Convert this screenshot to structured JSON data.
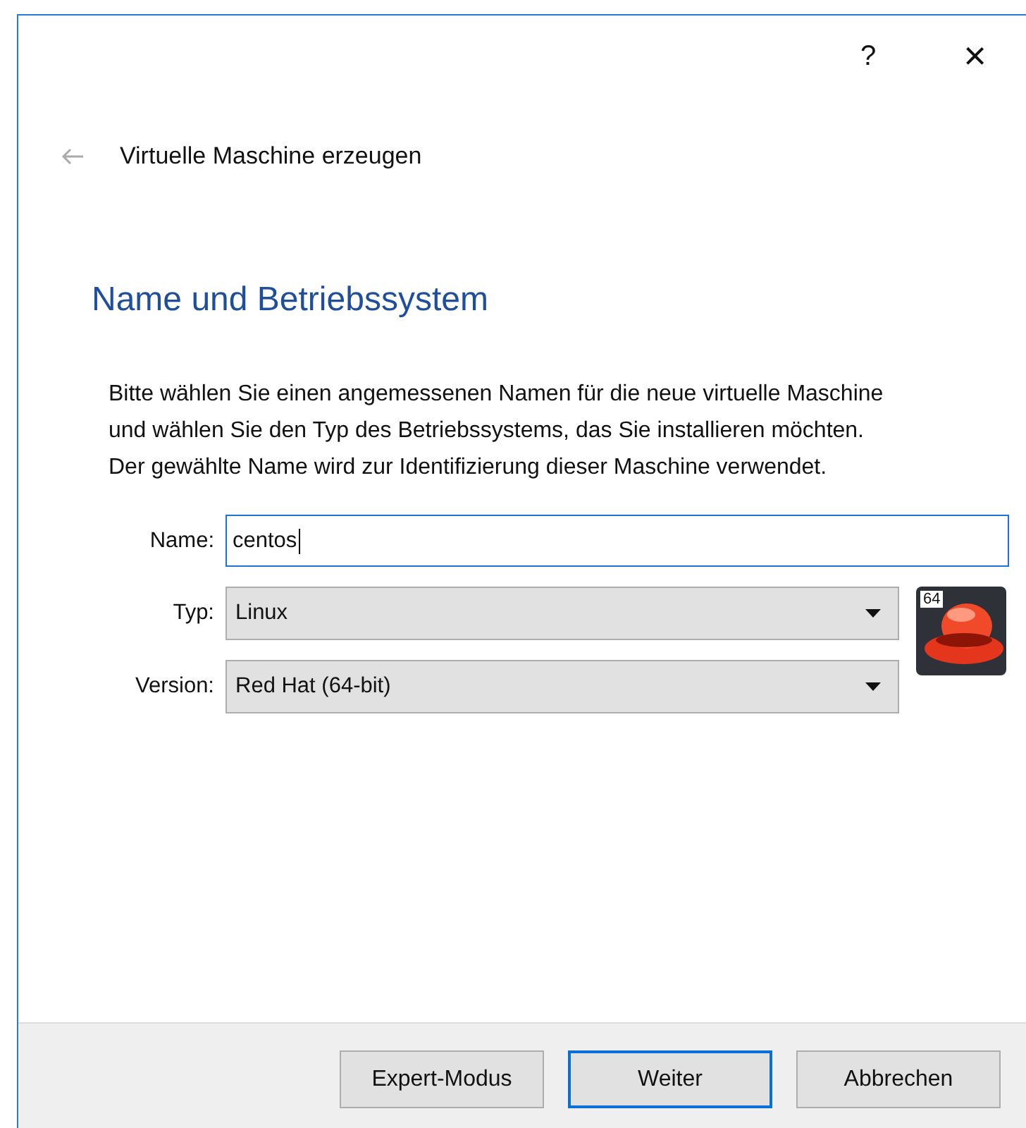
{
  "title_bar": {
    "help": "?",
    "close": "×"
  },
  "wizard": {
    "title": "Virtuelle Maschine erzeugen"
  },
  "page": {
    "heading": "Name und Betriebssystem",
    "description": "Bitte wählen Sie einen angemessenen Namen für die neue virtuelle Maschine und wählen Sie den Typ des Betriebssystems, das Sie installieren möchten. Der gewählte Name wird zur Identifizierung dieser Maschine verwendet."
  },
  "form": [
    {
      "kind": "text",
      "label": "Name:",
      "value": "centos",
      "focused": true
    },
    {
      "kind": "select",
      "label": "Typ:",
      "value": "Linux"
    },
    {
      "kind": "select",
      "label": "Version:",
      "value": "Red Hat (64-bit)"
    }
  ],
  "os_badge": "64",
  "buttons": [
    {
      "label": "Expert-Modus",
      "default": false
    },
    {
      "label": "Weiter",
      "default": true
    },
    {
      "label": "Abbrechen",
      "default": false
    }
  ]
}
